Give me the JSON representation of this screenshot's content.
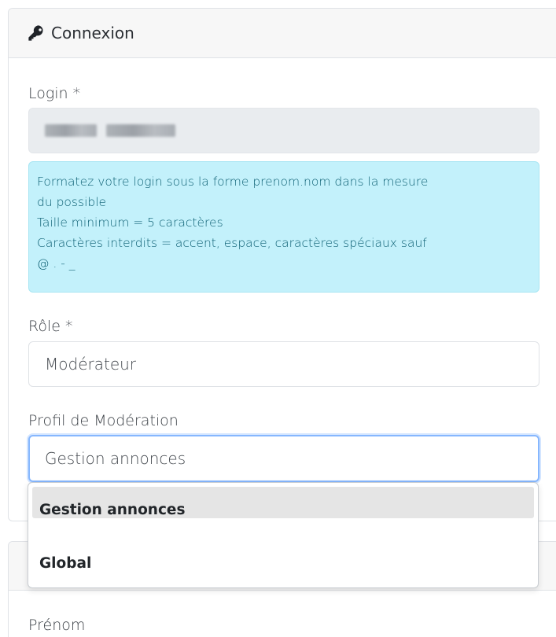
{
  "connexion": {
    "title": "Connexion",
    "icon": "key-icon",
    "login_label": "Login *",
    "login_value_blurred": true,
    "hint_lines": [
      "Formatez votre login sous la forme prenom.nom dans la mesure",
      "du possible",
      "Taille minimum = 5 caractères",
      "Caractères interdits = accent, espace, caractères spéciaux sauf",
      "@ . - _"
    ],
    "role_label": "Rôle *",
    "role_value": "Modérateur",
    "profile_label": "Profil de Modération",
    "profile_value": "Gestion annonces"
  },
  "dropdown": {
    "options": [
      "",
      "Gestion annonces",
      "Global"
    ],
    "highlighted_index": 0
  },
  "next_section": {
    "first_label": "Prénom"
  },
  "colors": {
    "hint_bg": "#c3f1fb",
    "hint_text": "#0c5f73",
    "focus_border": "#86b7fe",
    "disabled_bg": "#e9ecef"
  }
}
